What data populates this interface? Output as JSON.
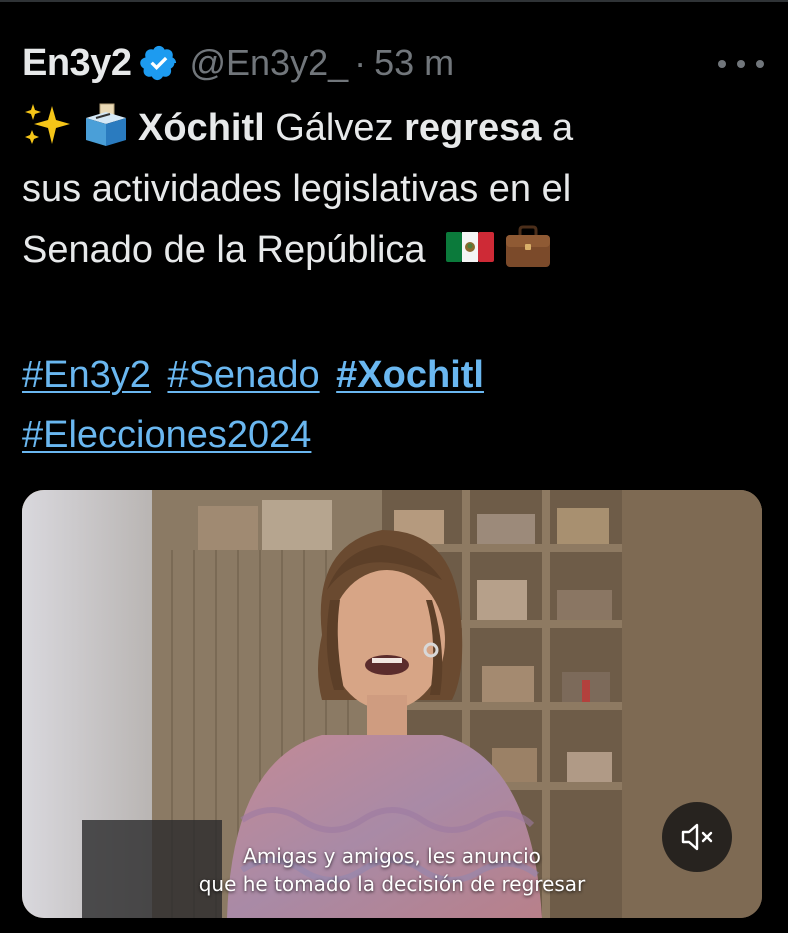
{
  "tweet": {
    "display_name": "En3y2",
    "verified_icon": "verified-badge-icon",
    "handle": "@En3y2_",
    "separator": "·",
    "time": "53 m",
    "text": {
      "line1_name_first": "Xóchitl",
      "line1_name_last": " Gálvez ",
      "line1_verb": "regresa",
      "line1_tail": " a",
      "line2": "sus actividades legislativas en el",
      "line3": "Senado de la República"
    },
    "emojis": [
      "sparkles-icon",
      "ballot-box-icon",
      "mexico-flag-icon",
      "briefcase-icon"
    ],
    "hashtags": [
      "#En3y2",
      "#Senado",
      "#Xochitl",
      "#Elecciones2024"
    ]
  },
  "media": {
    "caption_line1": "Amigas y amigos, les anuncio",
    "caption_line2": "que he tomado la decisión de regresar",
    "mute_icon": "volume-muted-icon"
  },
  "colors": {
    "background": "#000000",
    "text": "#e7e9ea",
    "secondary": "#71767b",
    "hashtag": "#6ab7f0",
    "verified": "#1d9bf0"
  }
}
